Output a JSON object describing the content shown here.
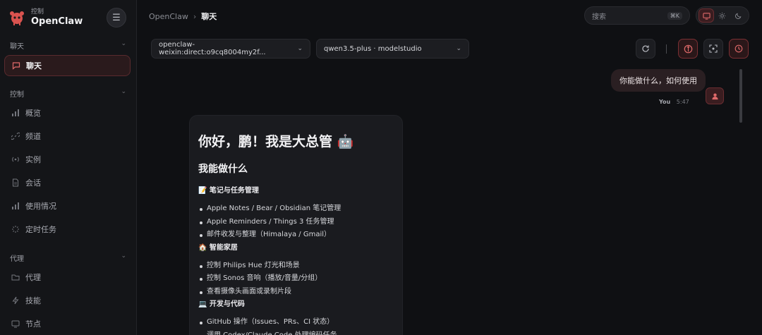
{
  "brand": {
    "sub": "控制",
    "name": "OpenClaw"
  },
  "sidebar": {
    "sections": [
      {
        "label": "聊天"
      },
      {
        "label": "控制"
      },
      {
        "label": "代理"
      }
    ],
    "items": [
      {
        "label": "聊天",
        "icon": "chat-icon"
      },
      {
        "label": "概览",
        "icon": "bar-chart-icon"
      },
      {
        "label": "频道",
        "icon": "link-icon"
      },
      {
        "label": "实例",
        "icon": "broadcast-icon"
      },
      {
        "label": "会话",
        "icon": "document-icon"
      },
      {
        "label": "使用情况",
        "icon": "bar-chart-icon"
      },
      {
        "label": "定时任务",
        "icon": "loader-icon"
      },
      {
        "label": "代理",
        "icon": "folder-icon"
      },
      {
        "label": "技能",
        "icon": "lightning-icon"
      },
      {
        "label": "节点",
        "icon": "monitor-icon"
      }
    ]
  },
  "breadcrumb": {
    "root": "OpenClaw",
    "separator": "›",
    "current": "聊天"
  },
  "search": {
    "placeholder": "搜索",
    "shortcut": "⌘K"
  },
  "selectors": {
    "session": "openclaw-weixin:direct:o9cq8004my2f...",
    "model": "qwen3.5-plus · modelstudio"
  },
  "chat": {
    "user_message": "你能做什么，如何使用",
    "user_name": "You",
    "user_time": "5:47",
    "reply": {
      "title": "你好，鹏！我是大总管 🤖",
      "subtitle": "我能做什么",
      "groups": [
        {
          "heading": "📝 笔记与任务管理",
          "items": [
            "Apple Notes / Bear / Obsidian 笔记管理",
            "Apple Reminders / Things 3 任务管理",
            "邮件收发与整理（Himalaya / Gmail）"
          ]
        },
        {
          "heading": "🏠 智能家居",
          "items": [
            "控制 Philips Hue 灯光和场景",
            "控制 Sonos 音响（播放/音量/分组）",
            "查看摄像头画面或录制片段"
          ]
        },
        {
          "heading": "💻 开发与代码",
          "items": [
            "GitHub 操作（Issues、PRs、CI 状态）",
            "调用 Codex/Claude Code 处理编码任务"
          ]
        }
      ]
    }
  },
  "colors": {
    "accent": "#e06a6a",
    "background": "#0f1013",
    "sidebar": "#141518"
  }
}
